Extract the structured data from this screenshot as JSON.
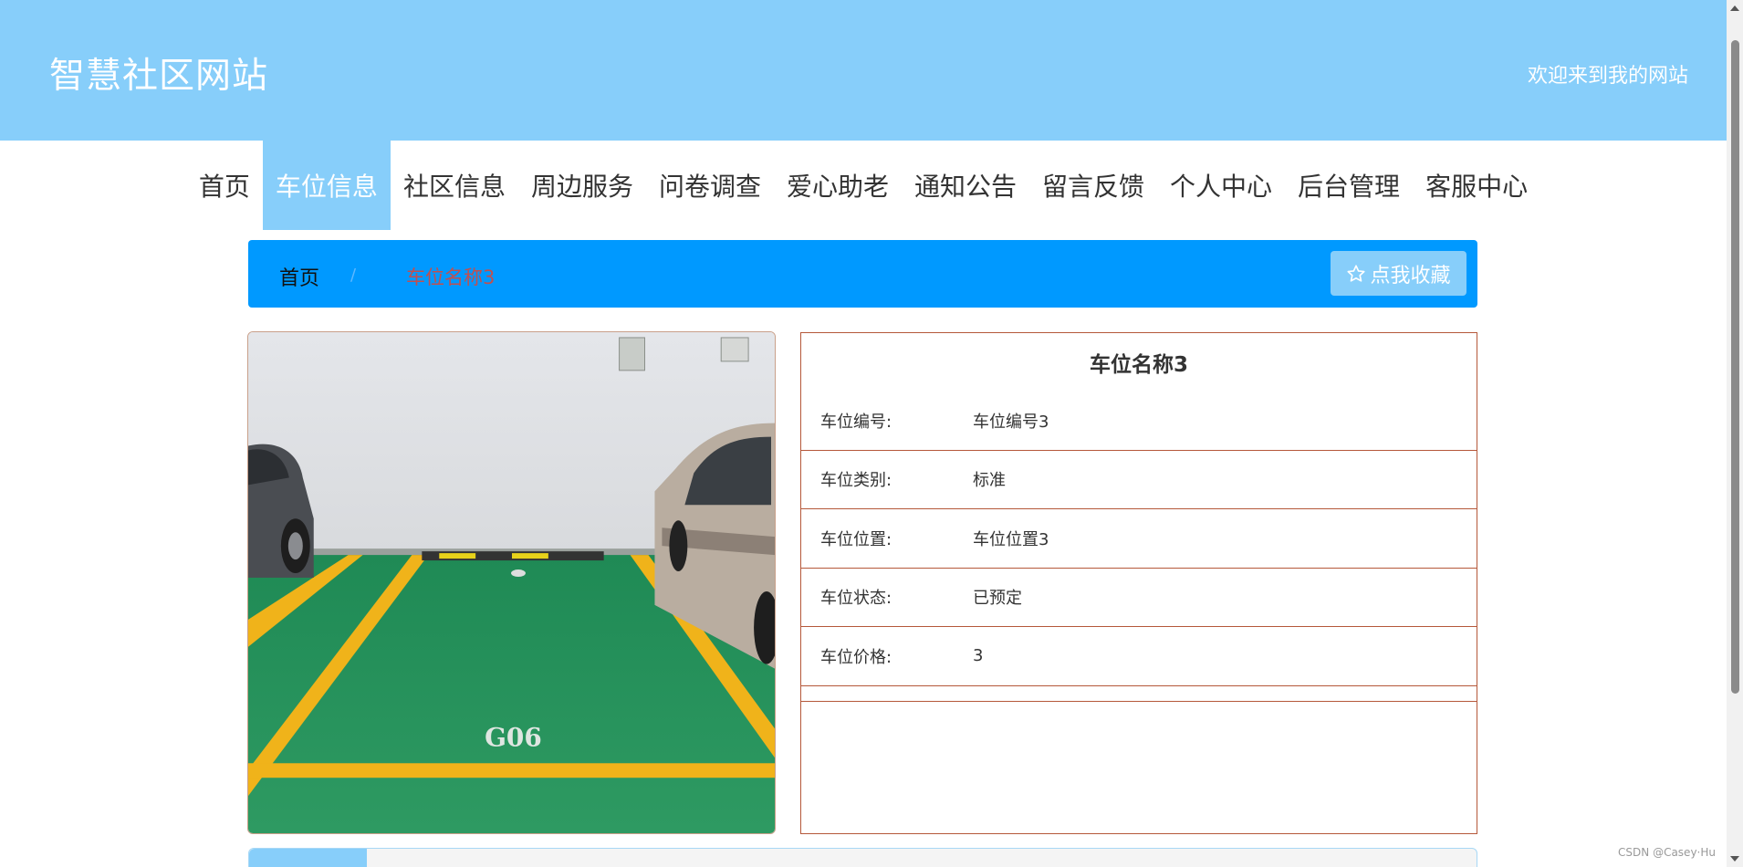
{
  "header": {
    "site_title": "智慧社区网站",
    "welcome": "欢迎来到我的网站"
  },
  "nav": {
    "items": [
      {
        "label": "首页",
        "active": false
      },
      {
        "label": "车位信息",
        "active": true
      },
      {
        "label": "社区信息",
        "active": false
      },
      {
        "label": "周边服务",
        "active": false
      },
      {
        "label": "问卷调查",
        "active": false
      },
      {
        "label": "爱心助老",
        "active": false
      },
      {
        "label": "通知公告",
        "active": false
      },
      {
        "label": "留言反馈",
        "active": false
      },
      {
        "label": "个人中心",
        "active": false
      },
      {
        "label": "后台管理",
        "active": false
      },
      {
        "label": "客服中心",
        "active": false
      }
    ]
  },
  "breadcrumb": {
    "home": "首页",
    "separator": "/",
    "current": "车位名称3",
    "favorite_label": "点我收藏",
    "favorite_icon": "star-outline-icon"
  },
  "detail": {
    "title": "车位名称3",
    "photo_marking": "G06",
    "fields": [
      {
        "label": "车位编号:",
        "value": "车位编号3"
      },
      {
        "label": "车位类别:",
        "value": "标准"
      },
      {
        "label": "车位位置:",
        "value": "车位位置3"
      },
      {
        "label": "车位状态:",
        "value": "已预定"
      },
      {
        "label": "车位价格:",
        "value": "3"
      }
    ]
  },
  "watermark": "CSDN @Casey·Hu",
  "colors": {
    "header_bg": "#87cefa",
    "breadcrumb_bg": "#0099ff",
    "border": "#b5583a",
    "current_text": "#c05050"
  }
}
